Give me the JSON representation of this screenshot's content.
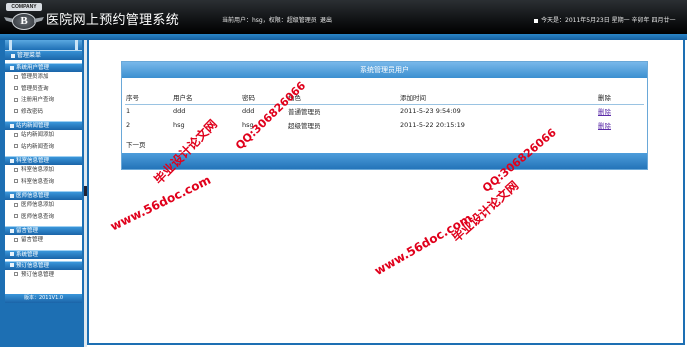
{
  "header": {
    "logo_badge_text": "COMPANY",
    "logo_emblem_text": "B",
    "title": "医院网上预约管理系统",
    "user_info": "当前用户：hsg，权限：超级管理员",
    "logout_label": "退出",
    "date_info": "今天是：2011年5月23日 星期一 辛卯年 四月廿一"
  },
  "sidebar": {
    "title": "管理菜单",
    "groups": [
      {
        "label": "系统用户管理",
        "items": [
          "管理员添加",
          "管理员查询",
          "注册用户查询",
          "修改密码"
        ]
      },
      {
        "label": "站内新闻管理",
        "items": [
          "站内新闻添加",
          "站内新闻查询"
        ]
      },
      {
        "label": "科室信息管理",
        "items": [
          "科室信息添加",
          "科室信息查询"
        ]
      },
      {
        "label": "医师信息管理",
        "items": [
          "医师信息添加",
          "医师信息查询"
        ]
      },
      {
        "label": "留言管理",
        "items": [
          "留言管理"
        ]
      },
      {
        "label": "系统管理",
        "items": []
      },
      {
        "label": "预订信息管理",
        "items": [
          "预订信息管理"
        ]
      }
    ],
    "version": "版本：2011V1.0"
  },
  "panel": {
    "title": "系统管理员用户",
    "columns": [
      "序号",
      "用户名",
      "密码",
      "角色",
      "添加时间",
      "删除"
    ],
    "rows": [
      {
        "no": "1",
        "username": "ddd",
        "password": "ddd",
        "role": "普通管理员",
        "time": "2011-5-23 9:54:09",
        "delete": "删除"
      },
      {
        "no": "2",
        "username": "hsg",
        "password": "hsg",
        "role": "超级管理员",
        "time": "2011-5-22 20:15:19",
        "delete": "删除"
      }
    ],
    "pager_label": "下一页"
  },
  "watermarks": {
    "url": "www.56doc.com",
    "qq": "QQ:306826066",
    "site": "毕业设计论文网"
  },
  "colors": {
    "header_bg": "#101214",
    "accent_blue": "#1d6fb3",
    "watermark_red": "#e0001b",
    "link_purple": "#5a2aa8"
  }
}
